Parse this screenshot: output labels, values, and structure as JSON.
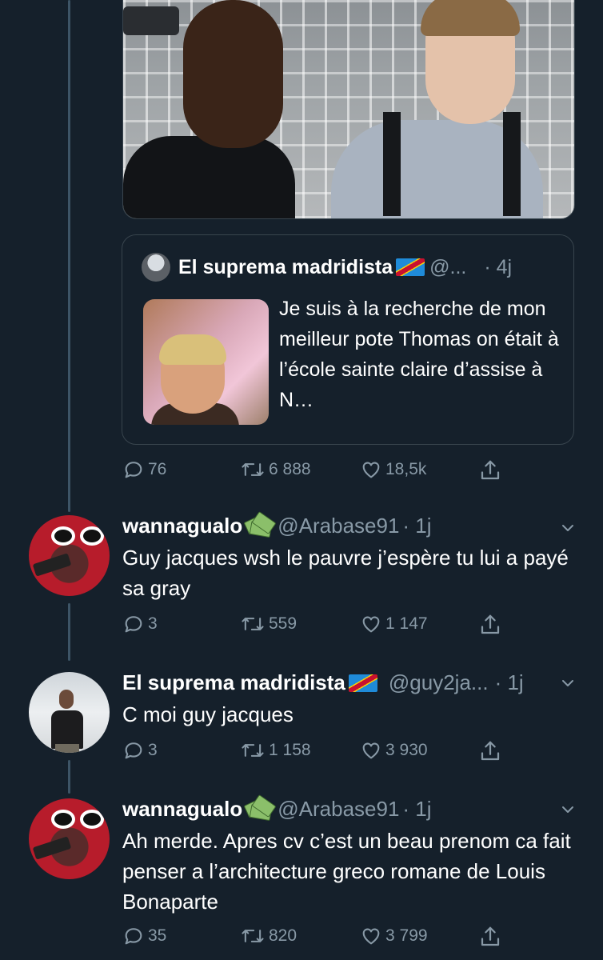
{
  "main_tweet": {
    "quote": {
      "author_name": "El suprema madridista",
      "handle": "@...",
      "time": "· 4j",
      "text": "Je suis à la recherche de mon meilleur pote Thomas on était à l’école sainte claire d’assise à N…"
    },
    "stats": {
      "replies": "76",
      "retweets": "6 888",
      "likes": "18,5k"
    }
  },
  "replies": [
    {
      "author_name": "wannagualo",
      "emoji": "money-with-wings",
      "handle": "@Arabase91",
      "time": "· 1j",
      "text": "Guy jacques wsh le pauvre j’espère tu lui a payé sa gray",
      "stats": {
        "replies": "3",
        "retweets": "559",
        "likes": "1 147"
      }
    },
    {
      "author_name": "El suprema madridista",
      "emoji": "flag-dr-congo",
      "handle": "@guy2ja...",
      "time": "· 1j",
      "text": "C moi guy jacques",
      "stats": {
        "replies": "3",
        "retweets": "1 158",
        "likes": "3 930"
      }
    },
    {
      "author_name": "wannagualo",
      "emoji": "money-with-wings",
      "handle": "@Arabase91",
      "time": "· 1j",
      "text": "Ah merde. Apres cv c’est un beau prenom ca fait penser a l’architecture greco romane de Louis Bonaparte",
      "stats": {
        "replies": "35",
        "retweets": "820",
        "likes": "3 799"
      }
    }
  ],
  "theme": {
    "background": "#15202b",
    "muted": "#8899a6",
    "border": "#38444d",
    "text": "#ffffff"
  }
}
